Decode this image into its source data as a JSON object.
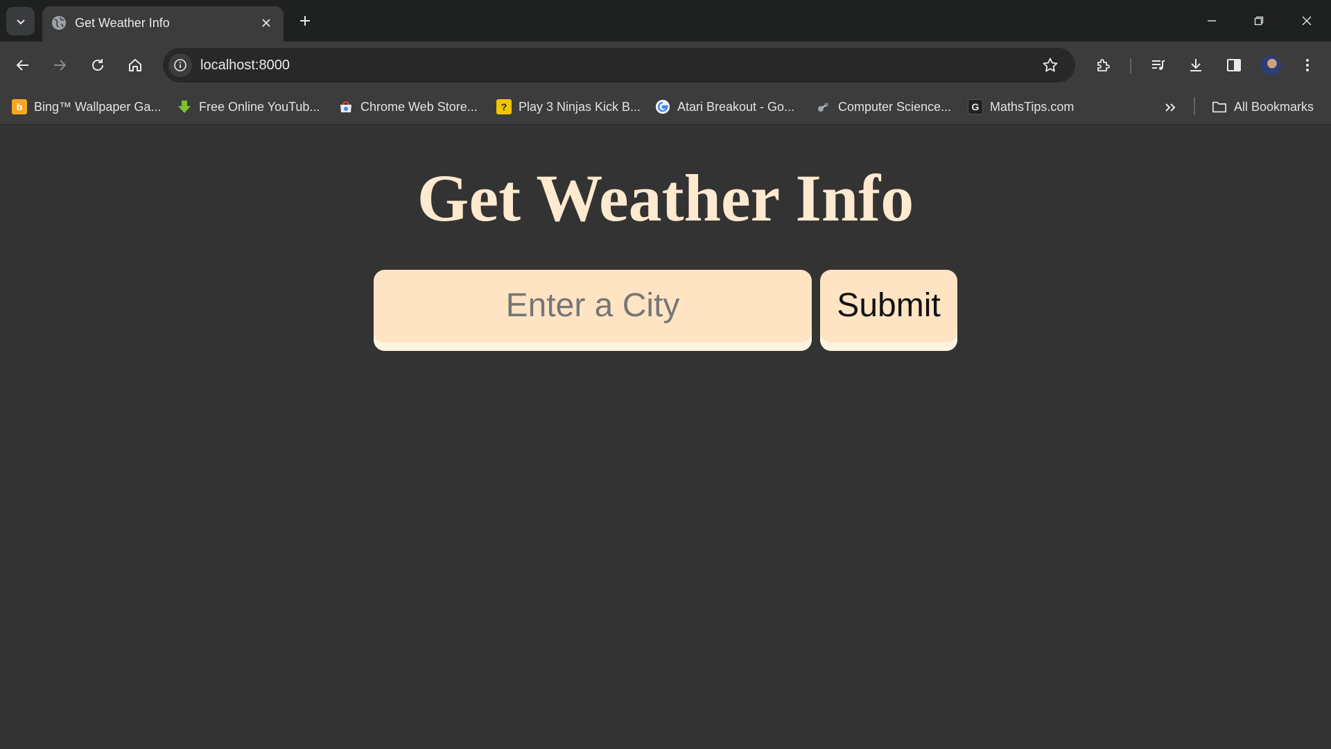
{
  "browser": {
    "tab": {
      "title": "Get Weather Info"
    },
    "address_bar": {
      "url": "localhost:8000"
    },
    "bookmarks": [
      {
        "label": "Bing™ Wallpaper Ga...",
        "icon": "bing-icon",
        "color": "#f5a623"
      },
      {
        "label": "Free Online YouTub...",
        "icon": "download-arrow-icon",
        "color": "#7cc22e"
      },
      {
        "label": "Chrome Web Store...",
        "icon": "web-store-icon",
        "color": "#e94235"
      },
      {
        "label": "Play 3 Ninjas Kick B...",
        "icon": "game-icon",
        "color": "#f2c500"
      },
      {
        "label": "Atari Breakout - Go...",
        "icon": "google-icon",
        "color": "#4285f4"
      },
      {
        "label": "Computer Science...",
        "icon": "circuit-icon",
        "color": "#9aa5b1"
      },
      {
        "label": "MathsTips.com",
        "icon": "g-letter-icon",
        "color": "#202124",
        "glyph": "G"
      }
    ],
    "all_bookmarks_label": "All Bookmarks"
  },
  "page": {
    "heading": "Get Weather Info",
    "city_input": {
      "placeholder": "Enter a City",
      "value": ""
    },
    "submit_label": "Submit"
  },
  "colors": {
    "page_background": "#333333",
    "heading": "#ffe9cf",
    "input_background": "#ffe4c4"
  }
}
